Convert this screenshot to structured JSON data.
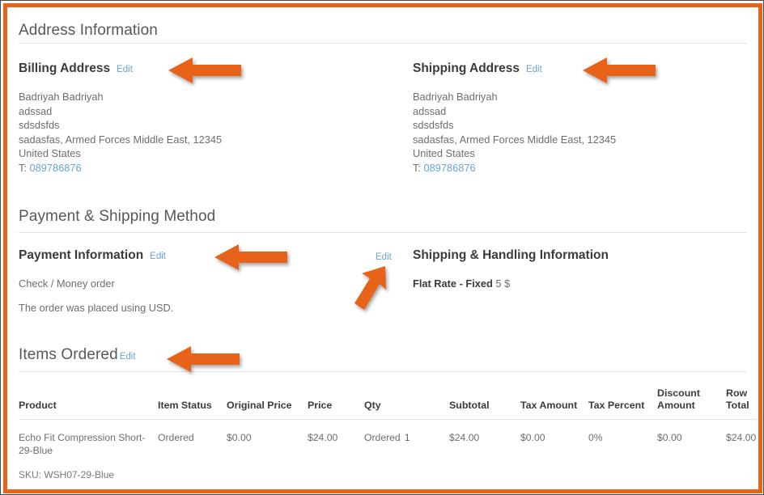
{
  "frame": {
    "border_color": "#e8631a",
    "outline_color": "#4a4a4a"
  },
  "sections": {
    "address_information": {
      "title": "Address Information"
    },
    "payment_shipping_method": {
      "title": "Payment & Shipping Method"
    },
    "items_ordered": {
      "title": "Items Ordered",
      "edit_label": "Edit"
    }
  },
  "billing": {
    "title": "Billing Address",
    "edit_label": "Edit",
    "name": "Badriyah Badriyah",
    "line1": "adssad",
    "line2": "sdsdsfds",
    "city_region_zip": "sadasfas, Armed Forces Middle East, 12345",
    "country": "United States",
    "phone_prefix": "T:",
    "phone": "089786876"
  },
  "shipping": {
    "title": "Shipping Address",
    "edit_label": "Edit",
    "name": "Badriyah Badriyah",
    "line1": "adssad",
    "line2": "sdsdsfds",
    "city_region_zip": "sadasfas, Armed Forces Middle East, 12345",
    "country": "United States",
    "phone_prefix": "T:",
    "phone": "089786876"
  },
  "payment": {
    "title": "Payment Information",
    "edit_label": "Edit",
    "method": "Check / Money order",
    "currency_note": "The order was placed using USD."
  },
  "shipping_handling": {
    "title": "Shipping & Handling Information",
    "edit_label": "Edit",
    "method_name": "Flat Rate - Fixed",
    "amount": "5 $"
  },
  "items_table": {
    "columns": [
      "Product",
      "Item Status",
      "Original Price",
      "Price",
      "Qty",
      "Subtotal",
      "Tax Amount",
      "Tax Percent",
      "Discount Amount",
      "Row Total"
    ],
    "rows": [
      {
        "product": "Echo Fit Compression Short-29-Blue",
        "sku": "SKU: WSH07-29-Blue",
        "item_status": "Ordered",
        "original_price": "$0.00",
        "price": "$24.00",
        "qty_label": "Ordered",
        "qty_value": "1",
        "subtotal": "$24.00",
        "tax_amount": "$0.00",
        "tax_percent": "0%",
        "discount_amount": "$0.00",
        "row_total": "$24.00"
      }
    ]
  },
  "annotations": {
    "arrow_color": "#e8631a",
    "arrows": [
      {
        "name": "arrow-to-billing-edit",
        "direction": "left"
      },
      {
        "name": "arrow-to-shipping-edit",
        "direction": "left"
      },
      {
        "name": "arrow-to-payment-edit",
        "direction": "left"
      },
      {
        "name": "arrow-to-shipping-method-edit",
        "direction": "up-right"
      },
      {
        "name": "arrow-to-items-ordered-edit",
        "direction": "left"
      }
    ]
  }
}
